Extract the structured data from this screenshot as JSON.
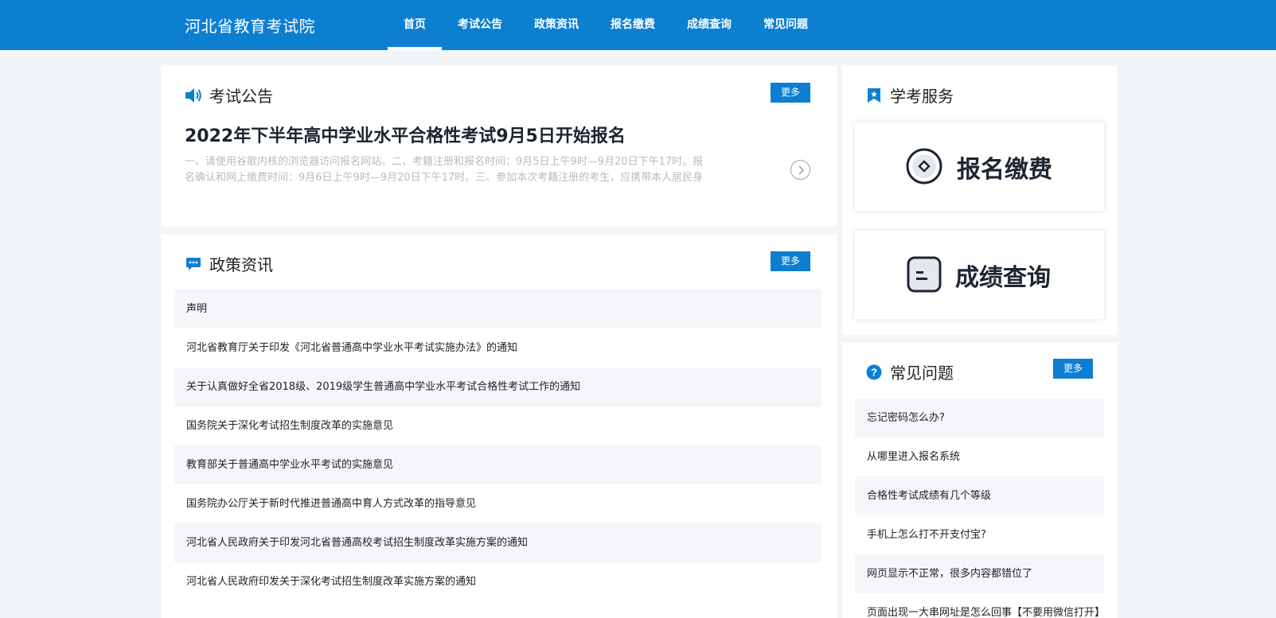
{
  "header": {
    "site_title": "河北省教育考试院",
    "nav": [
      {
        "label": "首页",
        "active": true
      },
      {
        "label": "考试公告"
      },
      {
        "label": "政策资讯"
      },
      {
        "label": "报名缴费"
      },
      {
        "label": "成绩查询"
      },
      {
        "label": "常见问题"
      }
    ]
  },
  "announcement": {
    "title": "考试公告",
    "more_label": "更多",
    "headline": "2022年下半年高中学业水平合格性考试9月5日开始报名",
    "summary": "一、请使用谷歌内核的浏览器访问报名网站。二、考籍注册和报名时间：9月5日上午9时—9月20日下午17时。报名确认和网上缴费时间：9月6日上午9时—9月20日下午17时。三、参加本次考籍注册的考生，应携带本人居民身份证在现"
  },
  "policy": {
    "title": "政策资讯",
    "more_label": "更多",
    "items": [
      "声明",
      "河北省教育厅关于印发《河北省普通高中学业水平考试实施办法》的通知",
      "关于认真做好全省2018级、2019级学生普通高中学业水平考试合格性考试工作的通知",
      "国务院关于深化考试招生制度改革的实施意见",
      "教育部关于普通高中学业水平考试的实施意见",
      "国务院办公厅关于新时代推进普通高中育人方式改革的指导意见",
      "河北省人民政府关于印发河北省普通高校考试招生制度改革实施方案的通知",
      "河北省人民政府印发关于深化考试招生制度改革实施方案的通知"
    ]
  },
  "services": {
    "title": "学考服务",
    "register_label": "报名缴费",
    "score_label": "成绩查询"
  },
  "faq": {
    "title": "常见问题",
    "more_label": "更多",
    "items": [
      "忘记密码怎么办?",
      "从哪里进入报名系统",
      "合格性考试成绩有几个等级",
      "手机上怎么打不开支付宝?",
      "网页显示不正常，很多内容都错位了",
      "页面出现一大串网址是怎么回事【不要用微信打开】"
    ]
  },
  "colors": {
    "primary": "#0d7fd1",
    "background": "#f3f6f9"
  }
}
